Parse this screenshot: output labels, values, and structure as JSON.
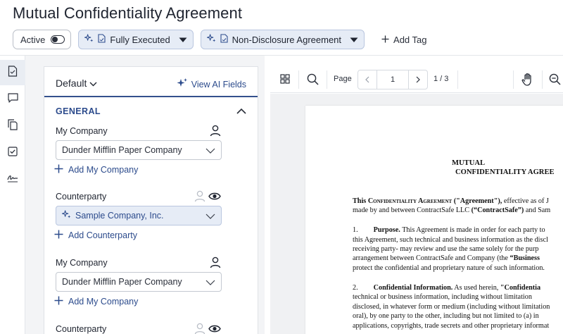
{
  "header": {
    "title": "Mutual Confidentiality Agreement",
    "active_label": "Active",
    "status_chip": "Fully Executed",
    "type_chip": "Non-Disclosure Agreement",
    "add_tag": "Add Tag"
  },
  "rail": {
    "items": [
      "document-icon",
      "comment-icon",
      "copy-icon",
      "checklist-icon",
      "signature-icon"
    ]
  },
  "panel": {
    "view_selector": "Default",
    "view_ai_fields": "View AI Fields",
    "section": "GENERAL",
    "fields": [
      {
        "label": "My Company",
        "value": "Dunder Mifflin Paper Company",
        "add": "Add My Company",
        "ai": false
      },
      {
        "label": "Counterparty",
        "value": "Sample Company, Inc.",
        "add": "Add Counterparty",
        "ai": true
      },
      {
        "label": "My Company",
        "value": "Dunder Mifflin Paper Company",
        "add": "Add My Company",
        "ai": false
      },
      {
        "label": "Counterparty",
        "value": "",
        "add": "",
        "ai": false
      }
    ]
  },
  "viewer": {
    "page_label": "Page",
    "page_number": "1",
    "page_total": "1 / 3"
  },
  "document": {
    "heading_line1": "MUTUAL",
    "heading_line2": "CONFIDENTIALITY AGREE",
    "p1": {
      "t1": "This ",
      "t2": "Confidentiality Agreement",
      "t3": " (\"Agreement\"),",
      "t4": " effective as of J",
      "line2a": "made by and between ContractSafe LLC ",
      "line2b": "(“ContractSafe”)",
      "line2c": " and Sam"
    },
    "p2": {
      "num": "1.",
      "title": "Purpose.",
      "l1": " This Agreement is made in order for each party to",
      "l2": "this Agreement, such technical and business information as the discl",
      "l3": "receiving party- may review and use the same solely for the purp",
      "l4a": "arrangement between ContractSafe and Company (the ",
      "l4b": "“Business",
      "l5": "protect the confidential and proprietary nature of such information."
    },
    "p3": {
      "num": "2.",
      "title": "Confidential Information.",
      "l1a": " As used herein, ",
      "l1b": "\"Confidentia",
      "l2": "technical or business information, including without limitation",
      "l3": "disclosed, in whatever form or medium (including without limitation",
      "l4": "oral), by one party to the other, including but not limited to (a) in",
      "l5": "applications, copyrights, trade secrets and other proprietary informat"
    }
  },
  "colors": {
    "accent": "#2c4b8c",
    "chip_bg": "#e6ecf6",
    "panel_bg": "#f3f4f6"
  }
}
